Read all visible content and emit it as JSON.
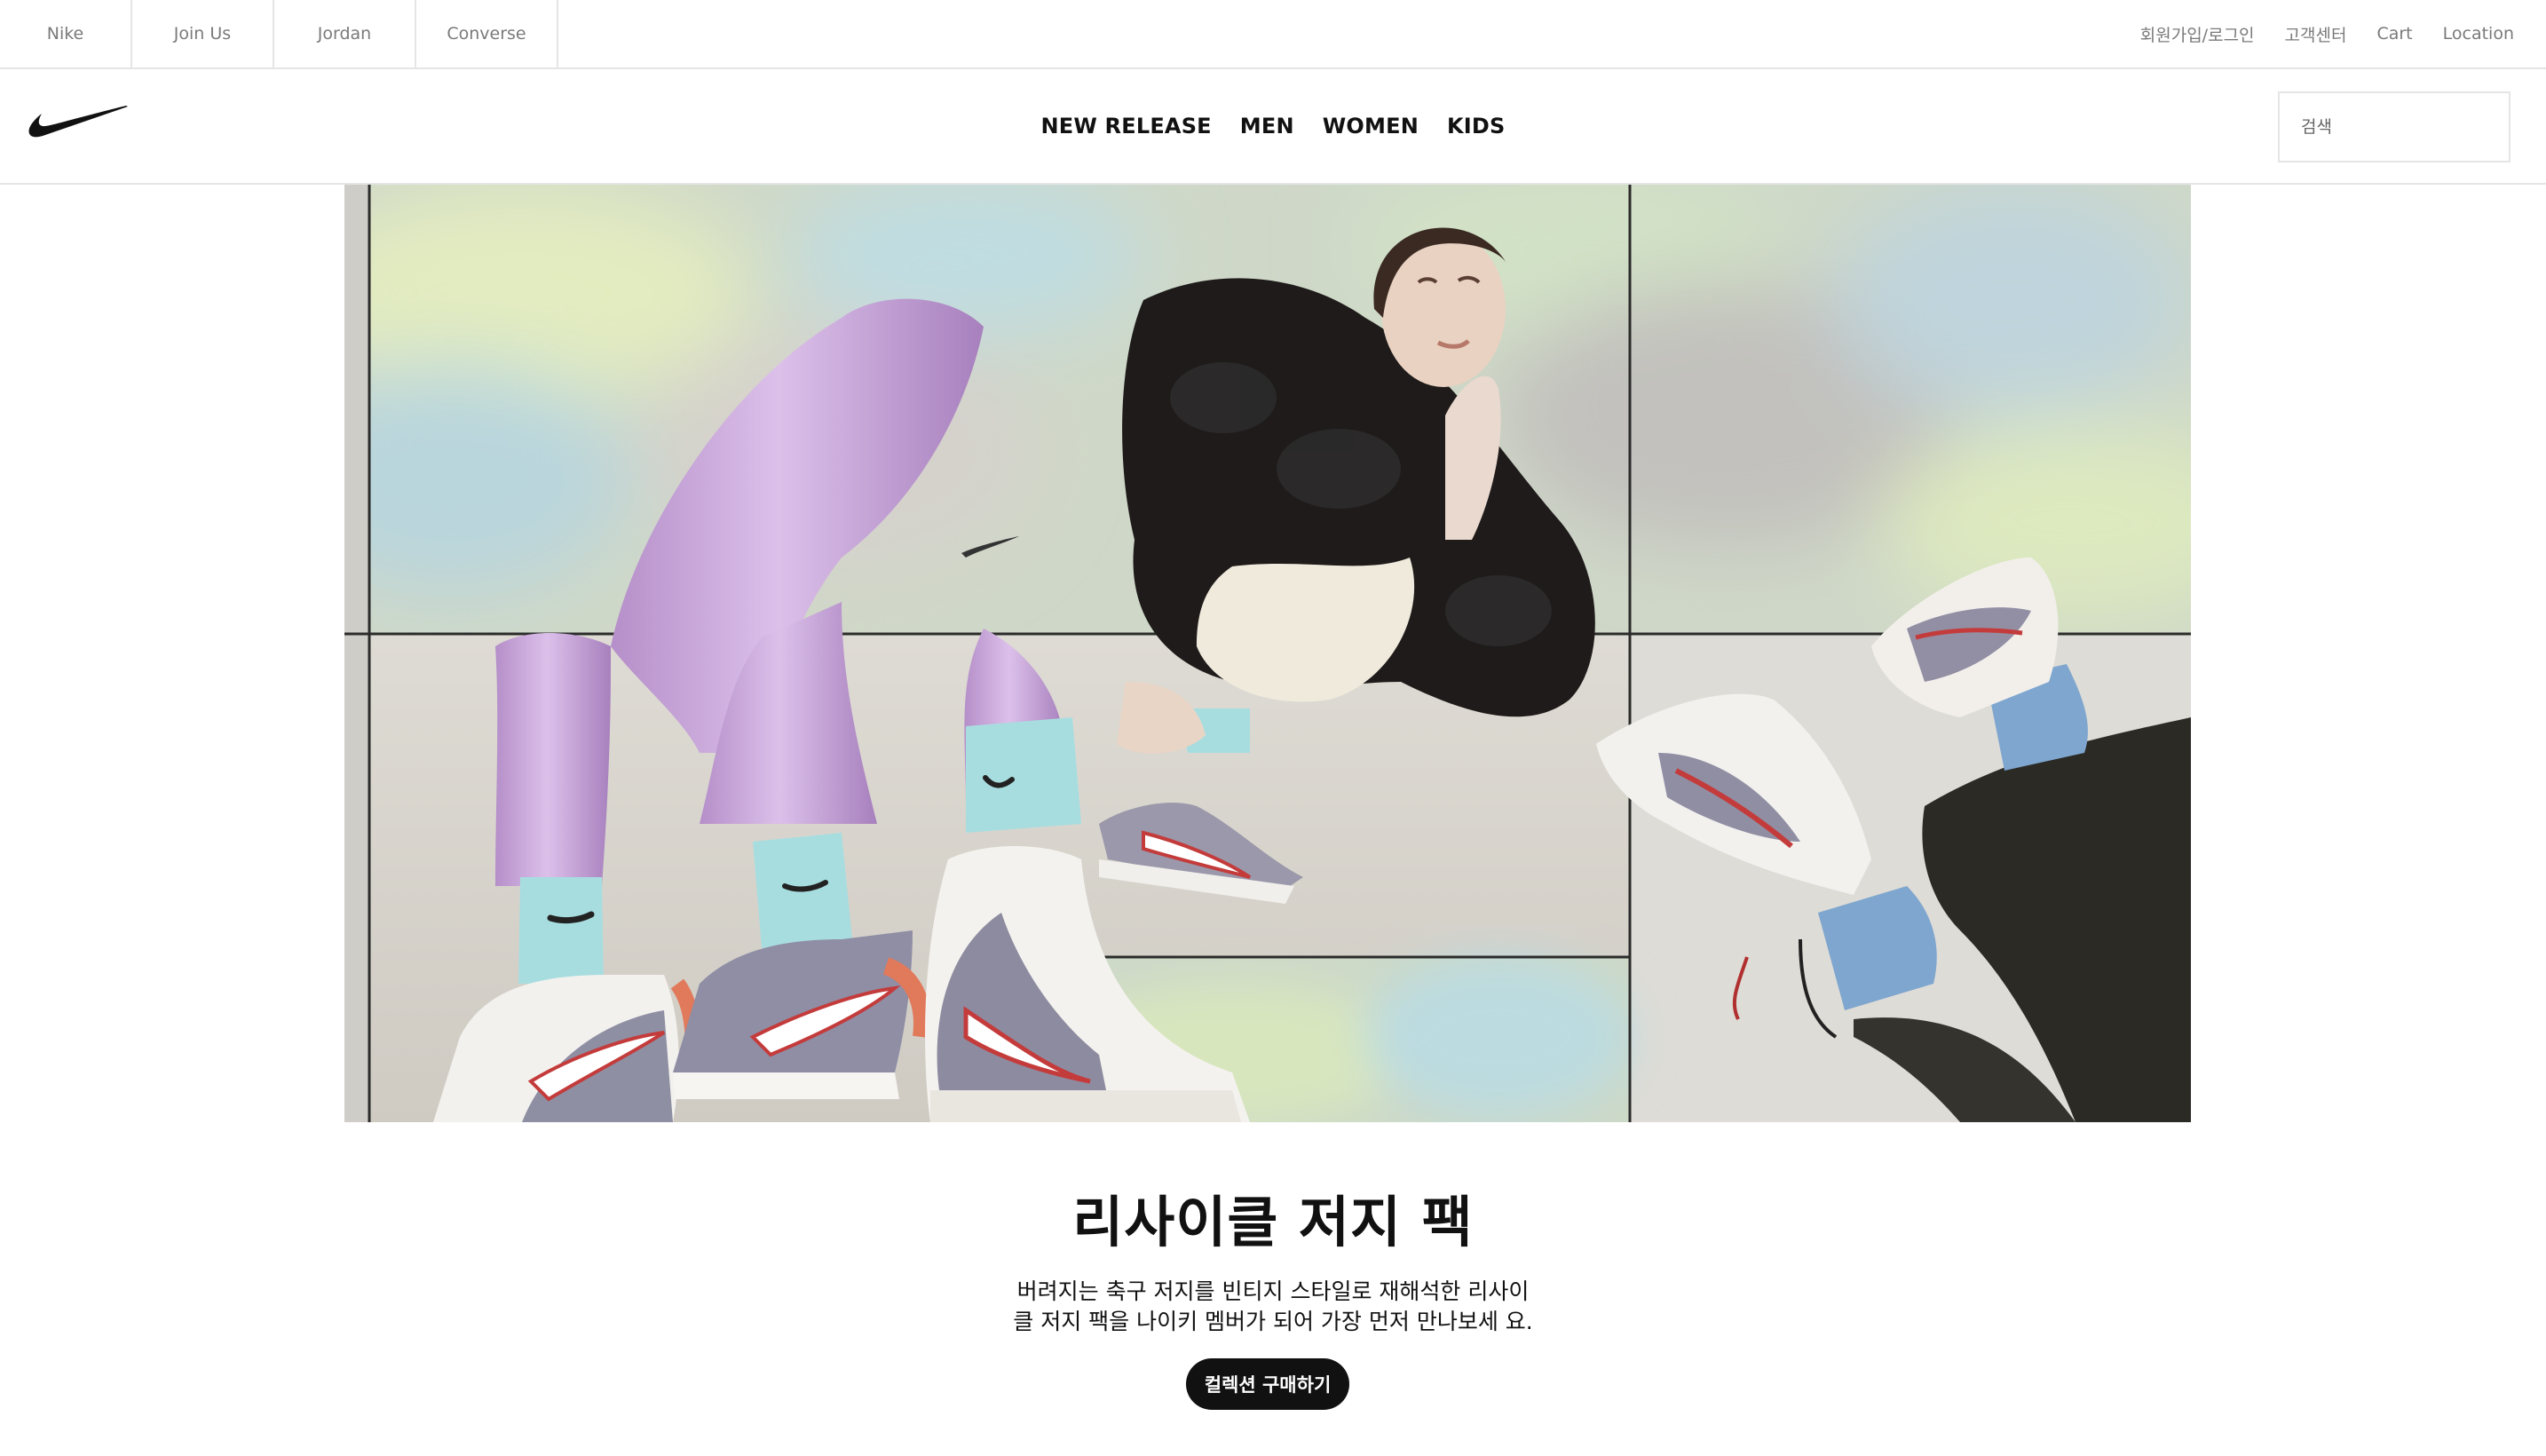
{
  "brand_tabs": [
    "Nike",
    "Join Us",
    "Jordan",
    "Converse"
  ],
  "util_links": [
    "회원가입/로그인",
    "고객센터",
    "Cart",
    "Location"
  ],
  "header": {
    "logo": "swoosh-logo-icon",
    "nav": [
      "NEW RELEASE",
      "MEN",
      "WOMEN",
      "KIDS"
    ],
    "search_placeholder": "검색"
  },
  "hero": {
    "image": "hero-photo-image"
  },
  "promo": {
    "title": "리사이클 저지 팩",
    "desc_line1": "버려지는 축구 저지를 빈티지 스타일로 재해석한 리사이",
    "desc_line2": "클 저지 팩을 나이키 멤버가 되어 가장 먼저 만나보세 요.",
    "button": "컬렉션 구매하기"
  },
  "colors": {
    "accent": "#111111",
    "muted_text": "#7a7a7a",
    "divider": "#e5e5e5",
    "legging": "#c9a6dc",
    "sock": "#a8dde0"
  }
}
